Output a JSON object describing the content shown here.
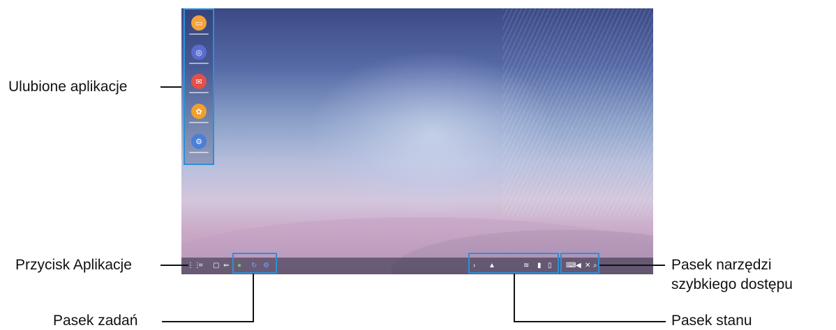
{
  "labels": {
    "favorite_apps": "Ulubione aplikacje",
    "apps_button": "Przycisk Aplikacje",
    "taskbar": "Pasek zadań",
    "quick_access_line1": "Pasek narzędzi",
    "quick_access_line2": "szybkiego dostępu",
    "status_bar": "Pasek stanu"
  },
  "sidebar": {
    "apps": [
      {
        "icon": "folder-icon",
        "color": "#f2a33c"
      },
      {
        "icon": "internet-icon",
        "color": "#5b6bd0"
      },
      {
        "icon": "email-icon",
        "color": "#e4504a"
      },
      {
        "icon": "gallery-icon",
        "color": "#f0a030"
      },
      {
        "icon": "settings-icon",
        "color": "#4b7fd6"
      }
    ]
  },
  "taskbar": {
    "nav_icons": [
      "apps-grid-icon",
      "screenshot-icon",
      "recent-apps-icon",
      "back-icon"
    ],
    "running_apps": [
      "phone-icon",
      "refresh-icon",
      "settings-icon"
    ],
    "status_icons": [
      "chevron-icon",
      "wifi-icon",
      "signal-icon",
      "battery-icon"
    ],
    "quick_icons": [
      "keyboard-icon",
      "volume-icon",
      "close-icon",
      "search-icon"
    ]
  },
  "colors": {
    "highlight": "#2d8fd6"
  }
}
